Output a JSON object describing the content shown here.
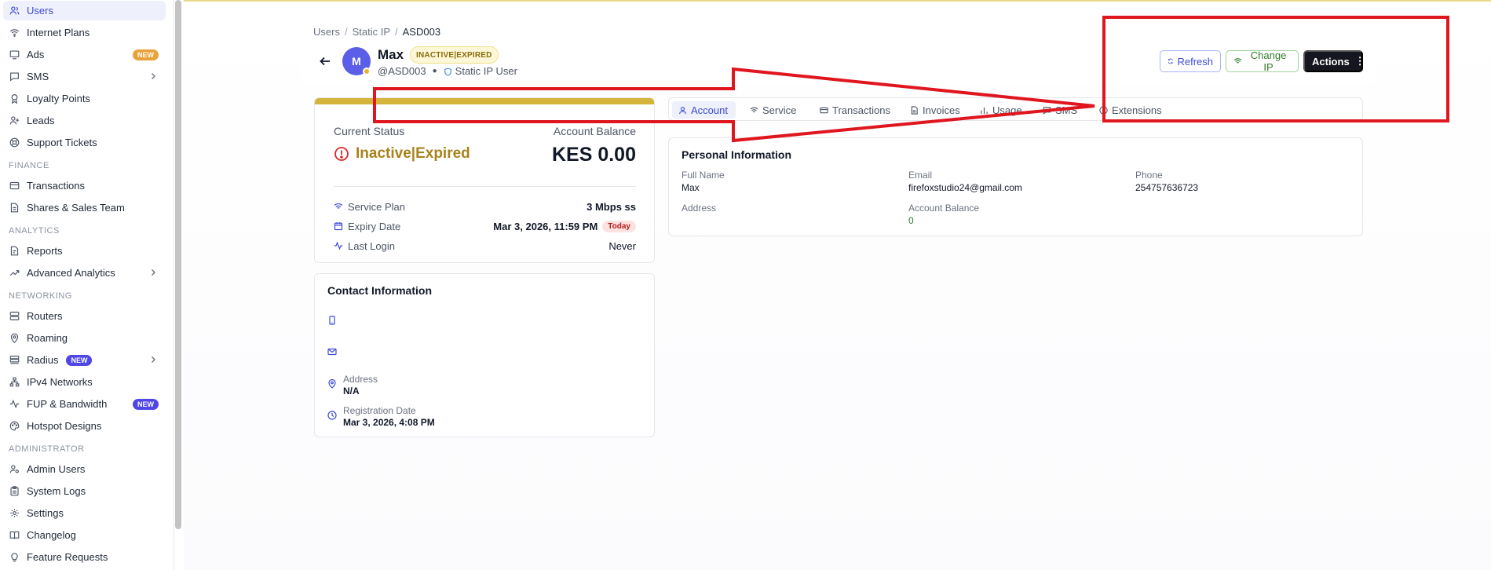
{
  "sidebar": {
    "items": [
      {
        "label": "Users",
        "icon": "users-icon"
      },
      {
        "label": "Internet Plans",
        "icon": "wifi-icon"
      },
      {
        "label": "Ads",
        "icon": "megaphone-icon",
        "badge": "NEW"
      },
      {
        "label": "SMS",
        "icon": "message-icon"
      },
      {
        "label": "Loyalty Points",
        "icon": "award-icon"
      },
      {
        "label": "Leads",
        "icon": "user-plus-icon"
      },
      {
        "label": "Support Tickets",
        "icon": "lifebuoy-icon"
      },
      {
        "label": "Transactions",
        "icon": "credit-card-icon"
      },
      {
        "label": "Shares & Sales Team",
        "icon": "document-icon"
      },
      {
        "label": "Reports",
        "icon": "file-icon"
      },
      {
        "label": "Advanced Analytics",
        "icon": "trending-up-icon"
      },
      {
        "label": "Routers",
        "icon": "server-icon"
      },
      {
        "label": "Roaming",
        "icon": "map-pin-icon"
      },
      {
        "label": "Radius",
        "icon": "layers-icon",
        "badge": "NEW"
      },
      {
        "label": "IPv4 Networks",
        "icon": "network-icon"
      },
      {
        "label": "FUP & Bandwidth",
        "icon": "activity-icon",
        "badge": "NEW"
      },
      {
        "label": "Hotspot Designs",
        "icon": "palette-icon"
      },
      {
        "label": "Admin Users",
        "icon": "user-cog-icon"
      },
      {
        "label": "System Logs",
        "icon": "clipboard-icon"
      },
      {
        "label": "Settings",
        "icon": "gear-icon"
      },
      {
        "label": "Changelog",
        "icon": "book-icon"
      },
      {
        "label": "Feature Requests",
        "icon": "lightbulb-icon"
      }
    ],
    "sections": {
      "finance": "FINANCE",
      "analytics": "ANALYTICS",
      "networking": "NETWORKING",
      "administrator": "ADMINISTRATOR"
    }
  },
  "breadcrumb": {
    "items": [
      "Users",
      "Static IP",
      "ASD003"
    ],
    "separator": "/"
  },
  "user": {
    "initial": "M",
    "name": "Max",
    "status_pill": "INACTIVE|EXPIRED",
    "handle": "@ASD003",
    "type": "Static IP User"
  },
  "actions": {
    "refresh": "Refresh",
    "change_ip": "Change IP",
    "actions": "Actions"
  },
  "status_card": {
    "current_status_label": "Current Status",
    "current_status": "Inactive|Expired",
    "balance_label": "Account Balance",
    "balance": "KES 0.00",
    "service_plan_label": "Service Plan",
    "service_plan": "3 Mbps ss",
    "expiry_label": "Expiry Date",
    "expiry": "Mar 3, 2026, 11:59 PM",
    "expiry_badge": "Today",
    "last_login_label": "Last Login",
    "last_login": "Never"
  },
  "contact": {
    "title": "Contact Information",
    "address_label": "Address",
    "address": "N/A",
    "registration_label": "Registration Date",
    "registration": "Mar 3, 2026, 4:08 PM"
  },
  "tabs": [
    {
      "label": "Account",
      "active": true
    },
    {
      "label": "Service"
    },
    {
      "label": "Transactions"
    },
    {
      "label": "Invoices"
    },
    {
      "label": "Usage"
    },
    {
      "label": "SMS"
    },
    {
      "label": "Extensions"
    }
  ],
  "personal": {
    "title": "Personal Information",
    "full_name_label": "Full Name",
    "full_name": "Max",
    "email_label": "Email",
    "email": "firefoxstudio24@gmail.com",
    "phone_label": "Phone",
    "phone": "254757636723",
    "address_label": "Address",
    "balance_label": "Account Balance",
    "balance": "0"
  },
  "colors": {
    "accent": "#3b4bd6",
    "status_warning": "#a8821a",
    "status_bar": "#d5b43b",
    "annotation": "#e0161f",
    "success": "#2f7a2a"
  }
}
